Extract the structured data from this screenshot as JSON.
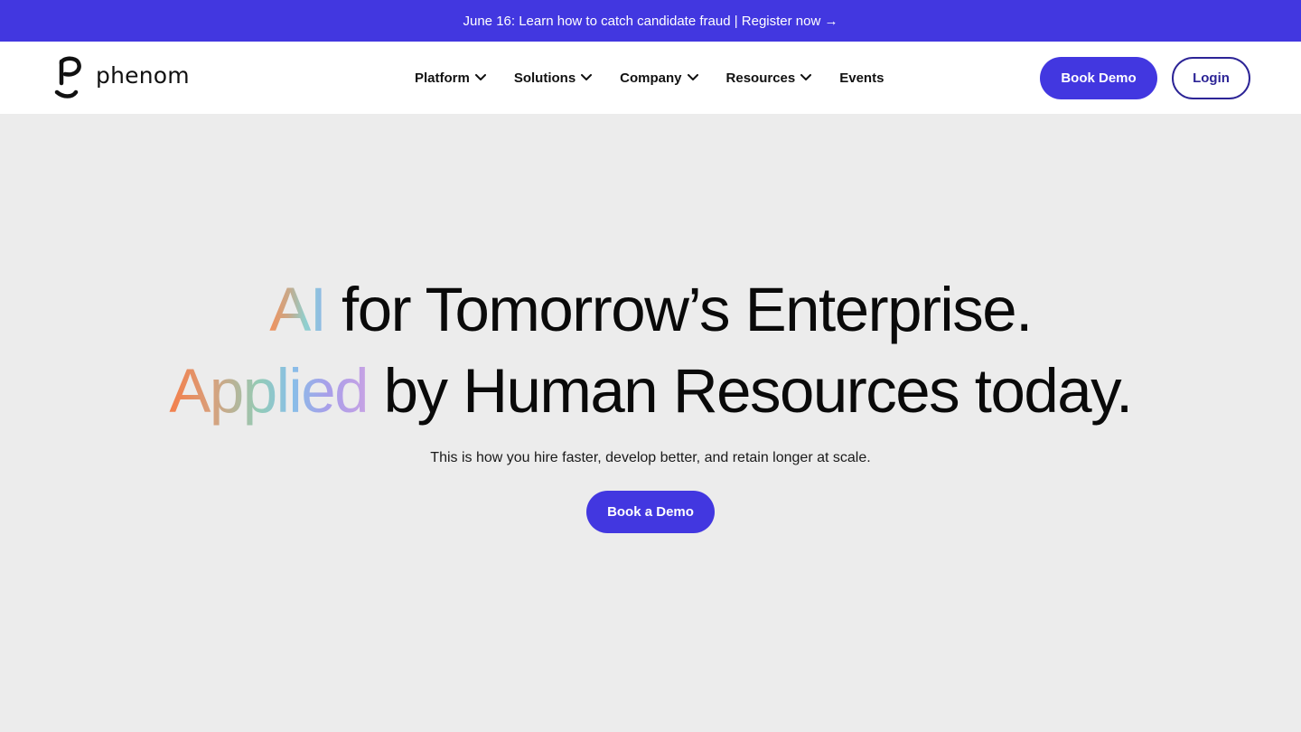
{
  "announcement": {
    "text": "June 16: Learn how to catch candidate fraud | Register now →"
  },
  "header": {
    "brand": "phenom",
    "nav": [
      {
        "label": "Platform",
        "has_dropdown": true,
        "icon": "chevron-down-icon"
      },
      {
        "label": "Solutions",
        "has_dropdown": true,
        "icon": "chevron-down-icon"
      },
      {
        "label": "Company",
        "has_dropdown": true,
        "icon": "chevron-down-icon"
      },
      {
        "label": "Resources",
        "has_dropdown": true,
        "icon": "chevron-down-icon"
      },
      {
        "label": "Events",
        "has_dropdown": false
      }
    ],
    "book_demo_label": "Book Demo",
    "login_label": "Login"
  },
  "hero": {
    "line1_highlight": "AI",
    "line1_rest": " for Tomorrow’s Enterprise.",
    "line2_highlight": "Applied",
    "line2_rest": " by Human Resources today.",
    "subtitle": "This is how you hire faster, develop better, and retain longer at scale.",
    "cta_label": "Book a Demo"
  },
  "colors": {
    "accent": "#4237e0",
    "login_outline": "#2c2496",
    "hero_background": "#ececec",
    "header_background": "#ffffff"
  }
}
